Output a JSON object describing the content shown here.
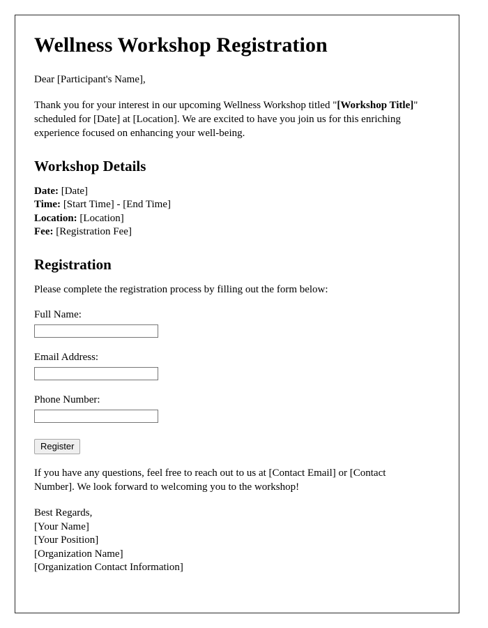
{
  "document": {
    "title": "Wellness Workshop Registration",
    "salutation": "Dear [Participant's Name],",
    "intro": {
      "part1": "Thank you for your interest in our upcoming Wellness Workshop titled \"",
      "workshop_title_placeholder": "[Workshop Title]",
      "part2": "\" scheduled for [Date] at [Location]. We are excited to have you join us for this enriching experience focused on enhancing your well-being."
    },
    "details_section": {
      "heading": "Workshop Details",
      "items": [
        {
          "label": "Date:",
          "value": "[Date]"
        },
        {
          "label": "Time:",
          "value": "[Start Time] - [End Time]"
        },
        {
          "label": "Location:",
          "value": "[Location]"
        },
        {
          "label": "Fee:",
          "value": "[Registration Fee]"
        }
      ]
    },
    "registration_section": {
      "heading": "Registration",
      "instruction": "Please complete the registration process by filling out the form below:",
      "fields": [
        {
          "label": "Full Name:",
          "value": "",
          "placeholder": ""
        },
        {
          "label": "Email Address:",
          "value": "",
          "placeholder": ""
        },
        {
          "label": "Phone Number:",
          "value": "",
          "placeholder": ""
        }
      ],
      "submit_label": "Register"
    },
    "closing": "If you have any questions, feel free to reach out to us at [Contact Email] or [Contact Number]. We look forward to welcoming you to the workshop!",
    "signature": [
      "Best Regards,",
      "[Your Name]",
      "[Your Position]",
      "[Organization Name]",
      "[Organization Contact Information]"
    ]
  },
  "colors": {
    "page_border": "#2b2b2b",
    "text": "#000000",
    "background": "#ffffff",
    "input_border": "#767676",
    "button_background": "#efefef",
    "button_border": "#a6a6a6"
  }
}
